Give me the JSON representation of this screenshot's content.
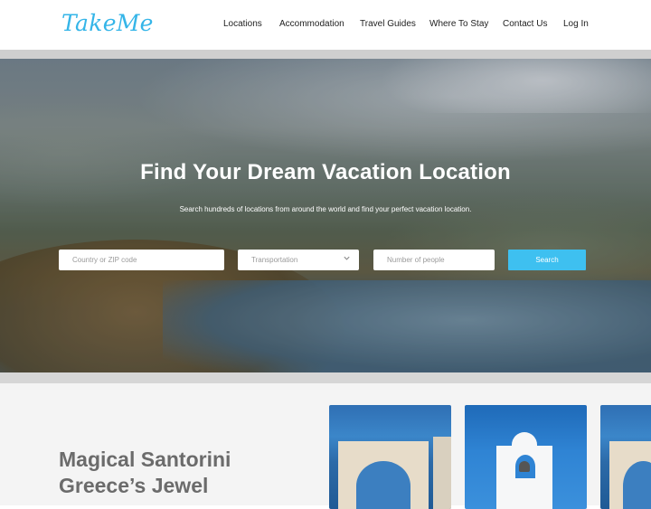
{
  "header": {
    "logo": "TakeMe",
    "nav": [
      "Locations",
      "Accommodation",
      "Travel Guides",
      "Where To Stay",
      "Contact Us",
      "Log In"
    ]
  },
  "hero": {
    "title": "Find Your Dream Vacation Location",
    "subtitle": "Search hundreds of locations from around the world and find your perfect vacation location.",
    "search": {
      "country_placeholder": "Country or ZIP code",
      "transport_selected": "Transportation",
      "people_placeholder": "Number of people",
      "button": "Search"
    }
  },
  "feature": {
    "title_line1": "Magical Santorini",
    "title_line2": "Greece’s Jewel"
  },
  "colors": {
    "brand": "#35b5e8",
    "search_button": "#3ec0f0"
  }
}
